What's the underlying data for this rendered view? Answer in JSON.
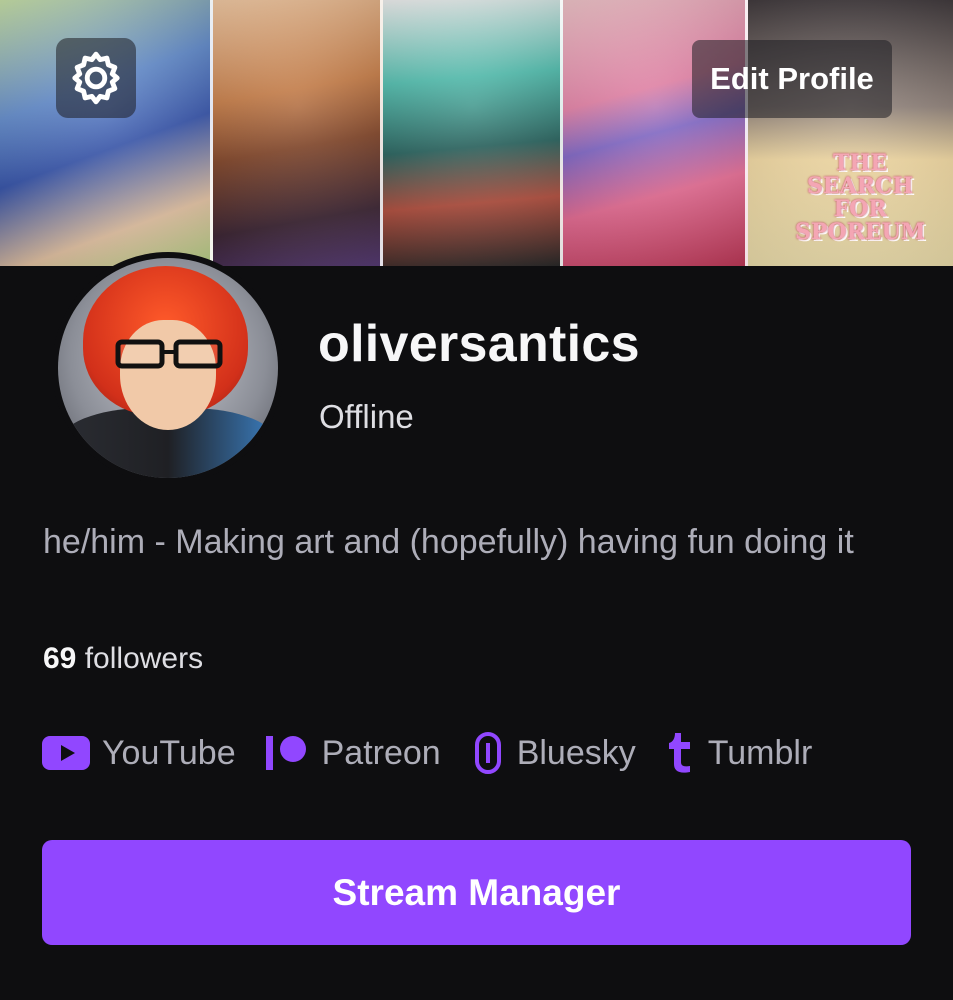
{
  "banner": {
    "logo_art_text": "THE SEARCH FOR SPOREUM"
  },
  "header": {
    "edit_profile_label": "Edit Profile"
  },
  "profile": {
    "username": "oliversantics",
    "status": "Offline",
    "bio": "he/him - Making art and (hopefully) having fun doing it",
    "followers_count": "69",
    "followers_label": "followers"
  },
  "links": [
    {
      "label": "YouTube",
      "icon": "youtube-icon"
    },
    {
      "label": "Patreon",
      "icon": "patreon-icon"
    },
    {
      "label": "Bluesky",
      "icon": "bluesky-icon"
    },
    {
      "label": "Tumblr",
      "icon": "tumblr-icon"
    }
  ],
  "actions": {
    "stream_manager_label": "Stream Manager"
  },
  "colors": {
    "background": "#0e0e10",
    "accent": "#9147ff",
    "text_primary": "#efeff1",
    "text_secondary": "#adadb8"
  }
}
